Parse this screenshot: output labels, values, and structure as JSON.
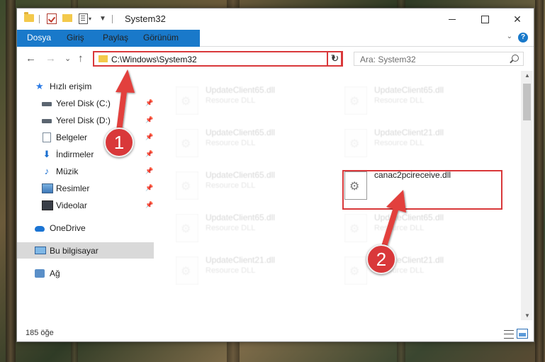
{
  "window": {
    "title": "System32"
  },
  "ribbon": {
    "tabs": [
      "Dosya",
      "Giriş",
      "Paylaş",
      "Görünüm"
    ],
    "help_label": "?"
  },
  "navigation": {
    "back_icon": "←",
    "forward_icon": "→",
    "history_icon": "⌄",
    "up_icon": "↑",
    "address": "C:\\Windows\\System32",
    "refresh_icon": "↻",
    "search_placeholder": "Ara: System32"
  },
  "sidebar": {
    "items": [
      {
        "label": "Hızlı erişim",
        "icon": "star-icon",
        "pinned": false
      },
      {
        "label": "Yerel Disk (C:)",
        "icon": "drive-icon",
        "pinned": true
      },
      {
        "label": "Yerel Disk (D:)",
        "icon": "drive-icon",
        "pinned": true
      },
      {
        "label": "Belgeler",
        "icon": "documents-icon",
        "pinned": true
      },
      {
        "label": "İndirmeler",
        "icon": "downloads-icon",
        "pinned": true
      },
      {
        "label": "Müzik",
        "icon": "music-icon",
        "pinned": true
      },
      {
        "label": "Resimler",
        "icon": "pictures-icon",
        "pinned": true
      },
      {
        "label": "Videolar",
        "icon": "videos-icon",
        "pinned": true
      },
      {
        "label": "OneDrive",
        "icon": "onedrive-icon",
        "pinned": false
      },
      {
        "label": "Bu bilgisayar",
        "icon": "this-pc-icon",
        "pinned": false,
        "selected": true
      },
      {
        "label": "Ağ",
        "icon": "network-icon",
        "pinned": false
      }
    ]
  },
  "files": [
    {
      "name": "UpdateClient65.dll",
      "type": "Resource DLL",
      "faded": true
    },
    {
      "name": "UpdateClient65.dll",
      "type": "Resource DLL",
      "faded": true
    },
    {
      "name": "UpdateClient65.dll",
      "type": "Resource DLL",
      "faded": true
    },
    {
      "name": "UpdateClient21.dll",
      "type": "Resource DLL",
      "faded": true
    },
    {
      "name": "UpdateClient65.dll",
      "type": "Resource DLL",
      "faded": true
    },
    {
      "name": "canac2pcireceive.dll",
      "type": "",
      "faded": false,
      "highlighted": true
    },
    {
      "name": "UpdateClient65.dll",
      "type": "Resource DLL",
      "faded": true
    },
    {
      "name": "UpdateClient65.dll",
      "type": "Resource DLL",
      "faded": true
    },
    {
      "name": "UpdateClient21.dll",
      "type": "Resource DLL",
      "faded": true
    },
    {
      "name": "UpdateClient21.dll",
      "type": "Resource DLL",
      "faded": true
    }
  ],
  "status": {
    "item_count": "185 öğe"
  },
  "annotations": {
    "step1": "1",
    "step2": "2",
    "color": "#d9383a"
  }
}
